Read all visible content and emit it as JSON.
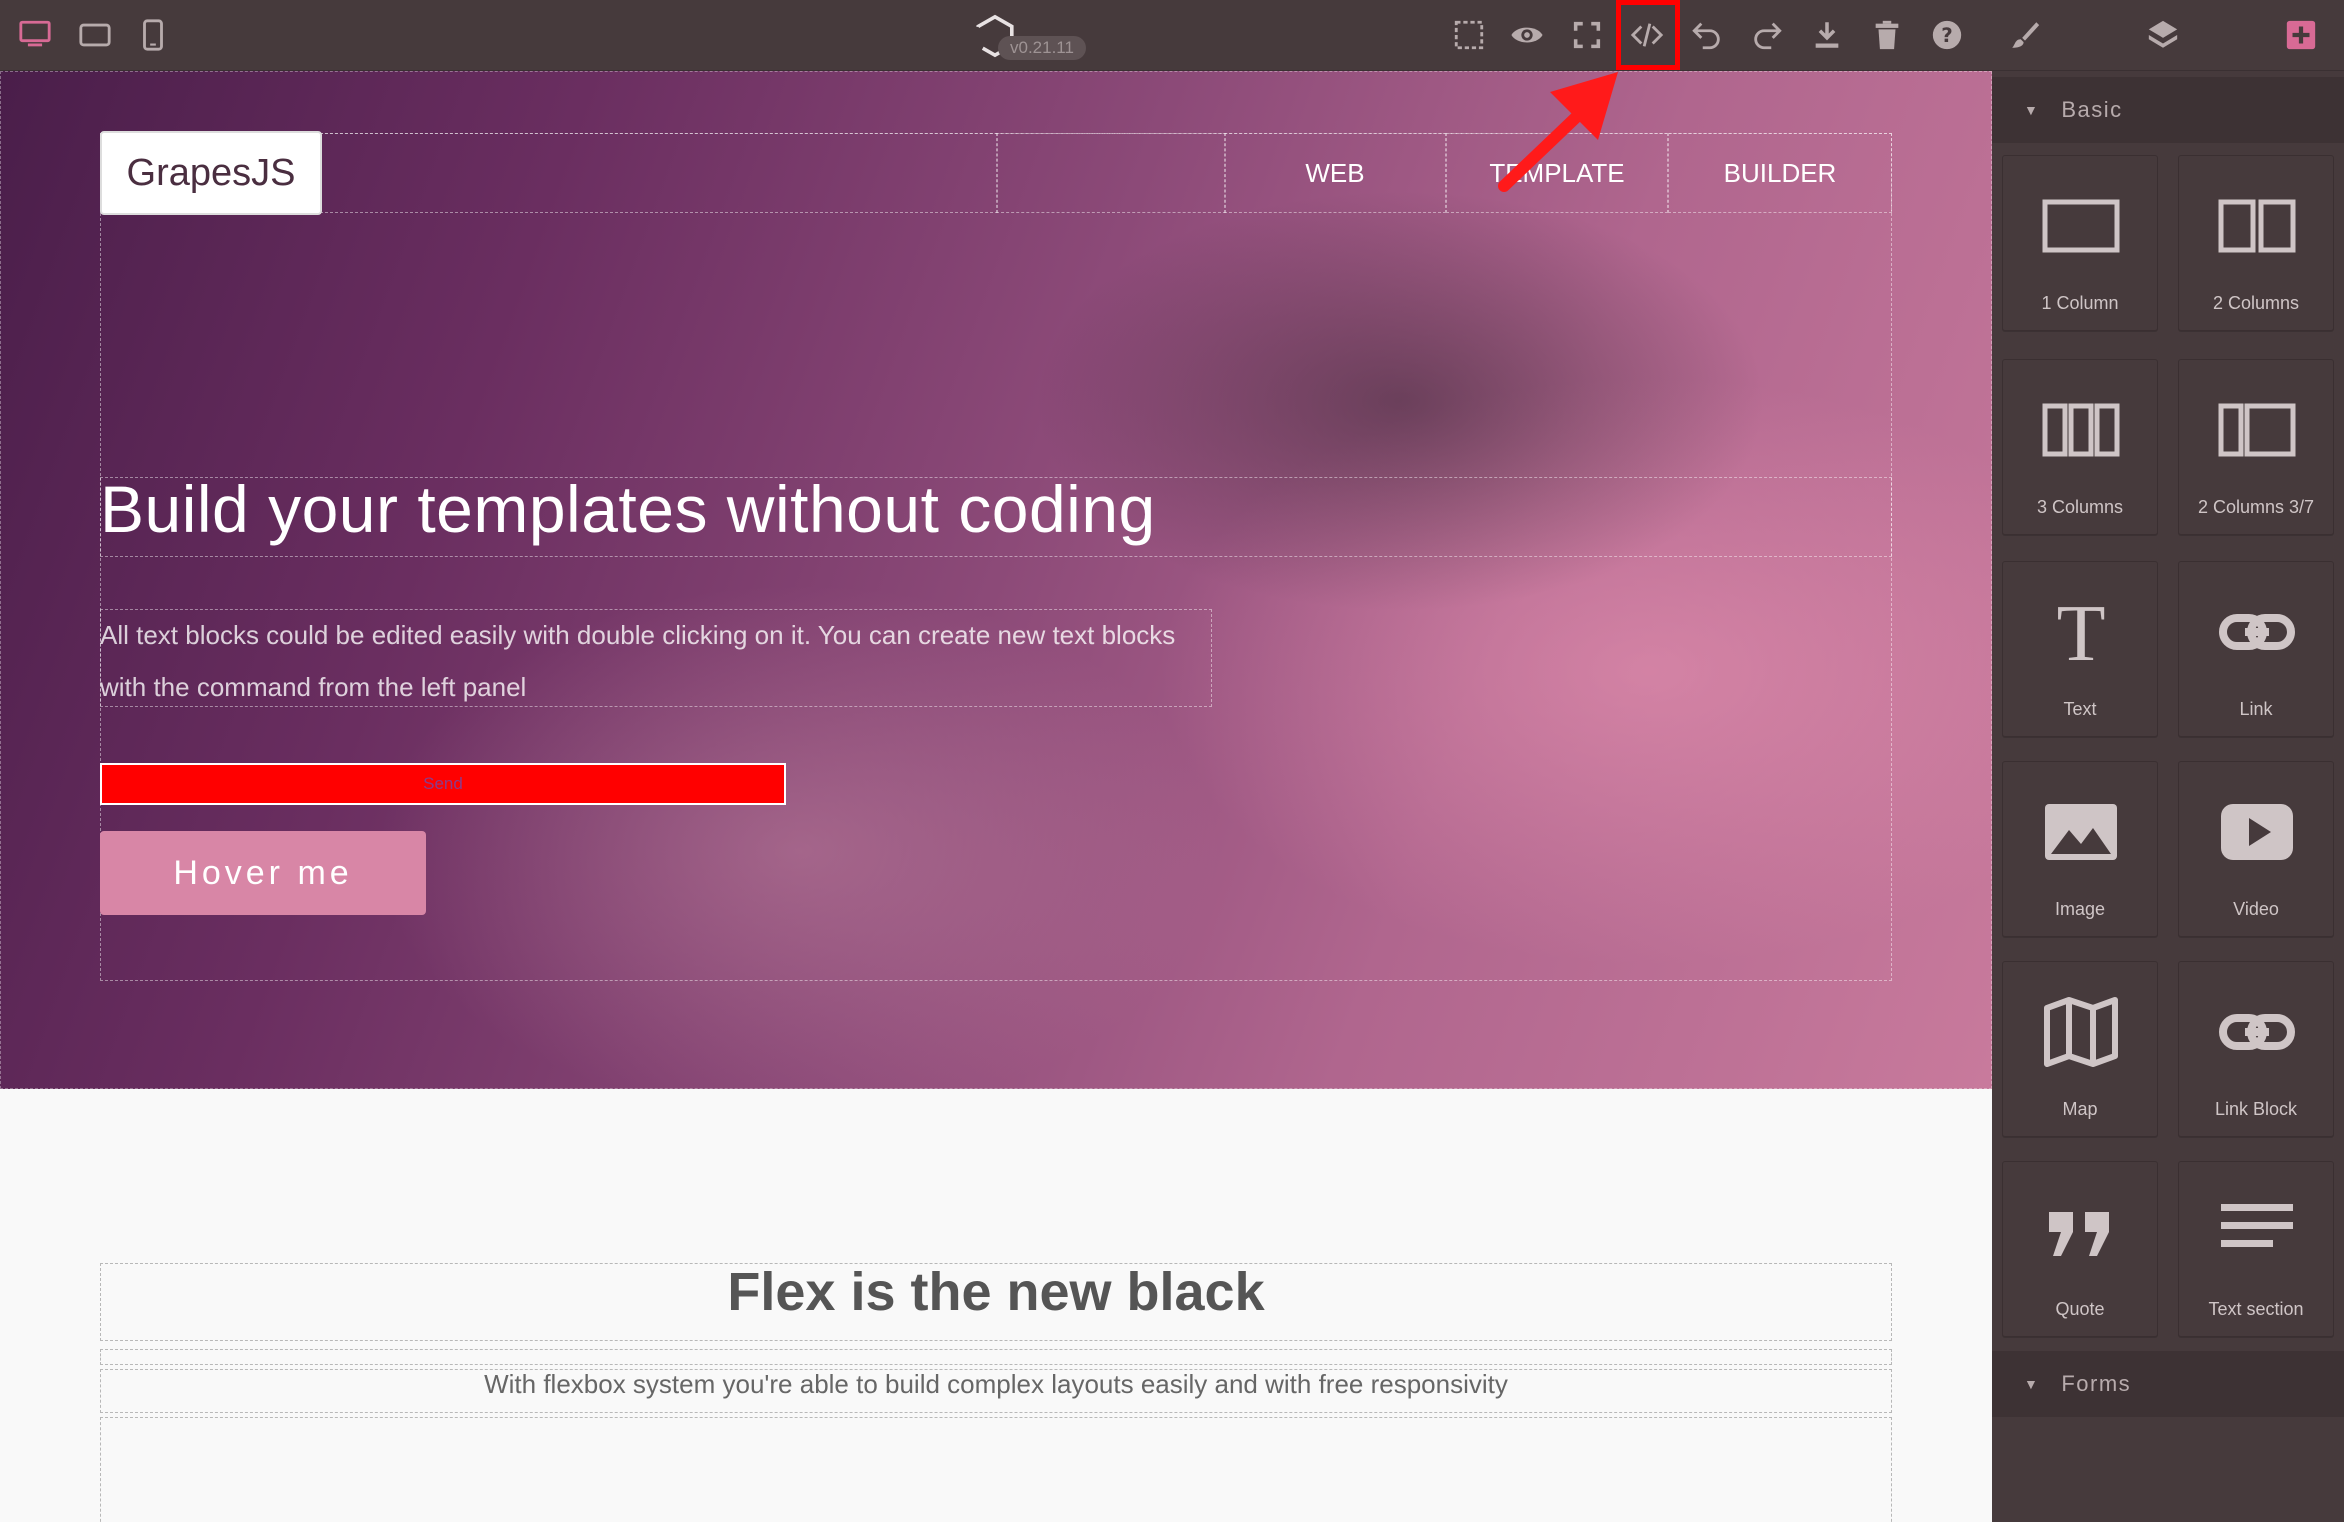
{
  "toolbar": {
    "version": "v0.21.11",
    "devices": [
      "desktop-icon",
      "tablet-icon",
      "mobile-icon"
    ],
    "actions": [
      "select-icon",
      "preview-icon",
      "fullscreen-icon",
      "code-icon",
      "undo-icon",
      "redo-icon",
      "download-icon",
      "trash-icon",
      "help-icon"
    ],
    "panels": [
      "brush-icon",
      "layers-icon",
      "add-block-icon"
    ],
    "accent": "#d86a95"
  },
  "hero": {
    "logo": "GrapesJS",
    "nav": [
      "WEB",
      "TEMPLATE",
      "BUILDER"
    ],
    "title": "Build your templates without coding",
    "text": "All text blocks could be edited easily with double clicking on it. You can create new text blocks with the command from the left panel",
    "send_label": "Send",
    "hover_label": "Hover me"
  },
  "section2": {
    "title": "Flex is the new black",
    "subtitle": "With flexbox system you're able to build complex layouts easily and with free responsivity"
  },
  "blocks": {
    "basic_label": "Basic",
    "forms_label": "Forms",
    "items": [
      {
        "label": "1 Column",
        "icon": "one-column-icon"
      },
      {
        "label": "2 Columns",
        "icon": "two-columns-icon"
      },
      {
        "label": "3 Columns",
        "icon": "three-columns-icon"
      },
      {
        "label": "2 Columns 3/7",
        "icon": "two-columns-37-icon"
      },
      {
        "label": "Text",
        "icon": "text-icon"
      },
      {
        "label": "Link",
        "icon": "link-icon"
      },
      {
        "label": "Image",
        "icon": "image-icon"
      },
      {
        "label": "Video",
        "icon": "video-icon"
      },
      {
        "label": "Map",
        "icon": "map-icon"
      },
      {
        "label": "Link Block",
        "icon": "link-block-icon"
      },
      {
        "label": "Quote",
        "icon": "quote-icon"
      },
      {
        "label": "Text section",
        "icon": "text-section-icon"
      }
    ]
  }
}
